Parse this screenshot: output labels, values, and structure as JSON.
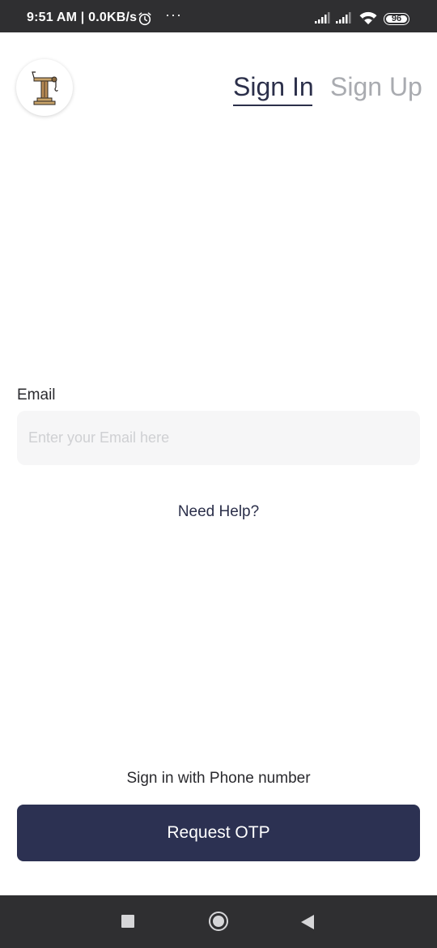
{
  "status_bar": {
    "time_text": "9:51 AM | 0.0KB/s",
    "overflow_text": "···",
    "battery_level": "96",
    "icons": [
      "alarm-icon",
      "signal-icon",
      "signal-icon",
      "wifi-icon",
      "battery-icon"
    ]
  },
  "header": {
    "logo_icon": "crane-logo-icon",
    "tabs": [
      {
        "label": "Sign In",
        "active": true
      },
      {
        "label": "Sign Up",
        "active": false
      }
    ]
  },
  "form": {
    "email_label": "Email",
    "email_placeholder": "Enter your Email here",
    "email_value": "",
    "need_help": "Need Help?"
  },
  "footer": {
    "phone_link": "Sign in with Phone number",
    "request_otp": "Request OTP"
  },
  "nav_bar": {
    "icons": [
      "recents-icon",
      "home-icon",
      "back-icon"
    ]
  },
  "colors": {
    "primary": "#2c3152",
    "status_bar_bg": "#2f2f31",
    "inactive_tab": "#a9abb0",
    "input_bg": "#f6f6f7"
  }
}
